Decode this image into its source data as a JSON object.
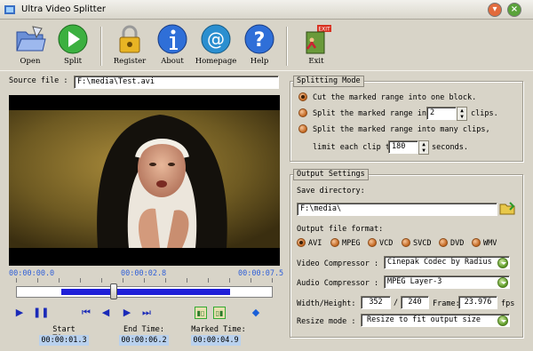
{
  "window": {
    "title": "Ultra Video Splitter"
  },
  "toolbar": {
    "open": "Open",
    "split": "Split",
    "register": "Register",
    "about": "About",
    "homepage": "Homepage",
    "help": "Help",
    "exit": "Exit",
    "exit_sign": "EXIT"
  },
  "source": {
    "label": "Source file :",
    "value": "F:\\media\\Test.avi"
  },
  "player": {
    "time_start": "00:00:00.0",
    "time_current": "00:00:02.8",
    "time_end": "00:00:07.5",
    "start_label": "Start Time:",
    "start_value": "00:00:01.3",
    "end_label": "End Time:",
    "end_value": "00:00:06.2",
    "marked_label": "Marked Time:",
    "marked_value": "00:00:04.9"
  },
  "splitting": {
    "title": "Splitting Mode",
    "opt1": "Cut the marked range into one block.",
    "opt2_a": "Split the marked range into",
    "opt2_value": "2",
    "opt2_b": "clips.",
    "opt3_a": "Split the marked range into many clips,",
    "opt3_b": "limit each clip to",
    "opt3_value": "180",
    "opt3_c": "seconds."
  },
  "output": {
    "title": "Output Settings",
    "save_label": "Save directory:",
    "save_value": "F:\\media\\",
    "format_label": "Output file format:",
    "formats": [
      "AVI",
      "MPEG",
      "VCD",
      "SVCD",
      "DVD",
      "WMV"
    ],
    "video_label": "Video Compressor :",
    "video_value": "Cinepak Codec by Radius",
    "audio_label": "Audio Compressor :",
    "audio_value": "MPEG Layer-3",
    "wh_label": "Width/Height:",
    "width": "352",
    "slash": "/",
    "height": "240",
    "frame_label": "Frame:",
    "frame_value": "23.976",
    "fps": "fps",
    "resize_label": "Resize mode :",
    "resize_value": "Resize to fit output size"
  }
}
